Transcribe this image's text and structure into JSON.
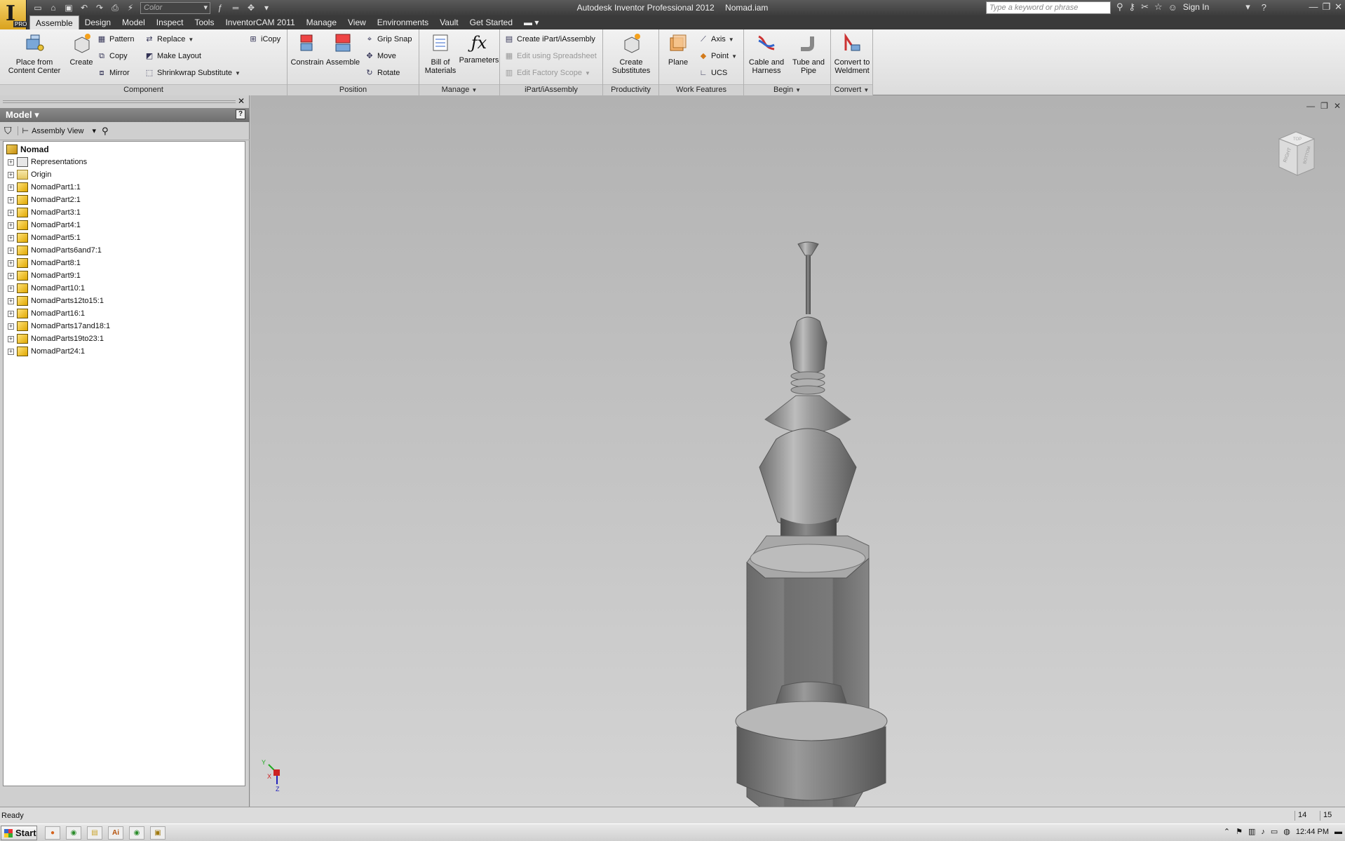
{
  "window": {
    "app_title": "Autodesk Inventor Professional 2012",
    "document": "Nomad.iam",
    "app_badge": "PRO",
    "color_combo": "Color",
    "search_placeholder": "Type a keyword or phrase",
    "sign_in": "Sign In"
  },
  "tabs": [
    "Assemble",
    "Design",
    "Model",
    "Inspect",
    "Tools",
    "InventorCAM 2011",
    "Manage",
    "View",
    "Environments",
    "Vault",
    "Get Started"
  ],
  "ribbon": {
    "component": {
      "title": "Component",
      "place": "Place from\nContent Center",
      "create": "Create",
      "pattern": "Pattern",
      "copy": "Copy",
      "mirror": "Mirror",
      "replace": "Replace",
      "make_layout": "Make Layout",
      "shrinkwrap": "Shrinkwrap Substitute",
      "icopy": "iCopy"
    },
    "position": {
      "title": "Position",
      "constrain": "Constrain",
      "assemble": "Assemble",
      "grip_snap": "Grip Snap",
      "move": "Move",
      "rotate": "Rotate"
    },
    "manage": {
      "title": "Manage",
      "bom": "Bill of\nMaterials",
      "parameters": "Parameters"
    },
    "ipart": {
      "title": "iPart/iAssembly",
      "create": "Create iPart/iAssembly",
      "edit_spreadsheet": "Edit using Spreadsheet",
      "edit_factory": "Edit Factory Scope"
    },
    "productivity": {
      "title": "Productivity",
      "create_substitutes": "Create\nSubstitutes"
    },
    "work_features": {
      "title": "Work Features",
      "plane": "Plane",
      "axis": "Axis",
      "point": "Point",
      "ucs": "UCS"
    },
    "begin": {
      "title": "Begin",
      "cable": "Cable and\nHarness",
      "tube": "Tube and\nPipe"
    },
    "convert": {
      "title": "Convert",
      "weldment": "Convert to\nWeldment"
    }
  },
  "browser": {
    "header": "Model",
    "view": "Assembly View",
    "root": "Nomad",
    "nodes": [
      {
        "label": "Representations",
        "kind": "repr"
      },
      {
        "label": "Origin",
        "kind": "folder"
      },
      {
        "label": "NomadPart1:1",
        "kind": "part"
      },
      {
        "label": "NomadPart2:1",
        "kind": "part"
      },
      {
        "label": "NomadPart3:1",
        "kind": "part"
      },
      {
        "label": "NomadPart4:1",
        "kind": "part"
      },
      {
        "label": "NomadPart5:1",
        "kind": "part"
      },
      {
        "label": "NomadParts6and7:1",
        "kind": "part"
      },
      {
        "label": "NomadPart8:1",
        "kind": "part"
      },
      {
        "label": "NomadPart9:1",
        "kind": "part"
      },
      {
        "label": "NomadPart10:1",
        "kind": "part"
      },
      {
        "label": "NomadParts12to15:1",
        "kind": "part"
      },
      {
        "label": "NomadPart16:1",
        "kind": "part"
      },
      {
        "label": "NomadParts17and18:1",
        "kind": "part"
      },
      {
        "label": "NomadParts19to23:1",
        "kind": "part"
      },
      {
        "label": "NomadPart24:1",
        "kind": "part"
      }
    ]
  },
  "viewcube": {
    "right": "RIGHT",
    "bottom": "BOTTOM",
    "top": "TOP"
  },
  "triad": {
    "x": "X",
    "y": "Y",
    "z": "Z"
  },
  "status": {
    "text": "Ready",
    "num1": "14",
    "num2": "15"
  },
  "taskbar": {
    "start": "Start",
    "clock": "12:44 PM"
  },
  "colors": {
    "accent": "#f0c040",
    "viewport_top": "#b2b2b2",
    "viewport_bottom": "#d4d4d4"
  }
}
